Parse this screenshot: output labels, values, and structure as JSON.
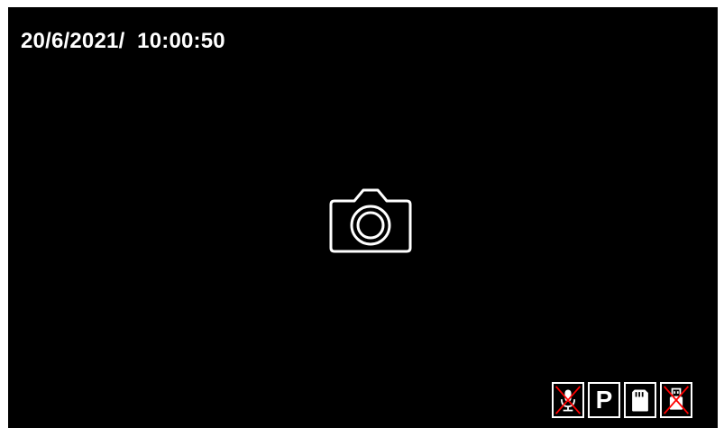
{
  "overlay": {
    "datetime": "20/6/2021/  10:00:50"
  },
  "mode": {
    "icon": "camera-icon",
    "label": "photo mode"
  },
  "status_bar": {
    "icons": [
      {
        "name": "microphone-off-icon",
        "state": "disabled"
      },
      {
        "name": "parking-mode-icon",
        "label": "P",
        "state": "enabled"
      },
      {
        "name": "sd-card-icon",
        "state": "enabled"
      },
      {
        "name": "usb-off-icon",
        "state": "disabled"
      }
    ]
  },
  "colors": {
    "screen_bg": "#000000",
    "foreground": "#ffffff",
    "disabled_cross": "#ff0000"
  }
}
